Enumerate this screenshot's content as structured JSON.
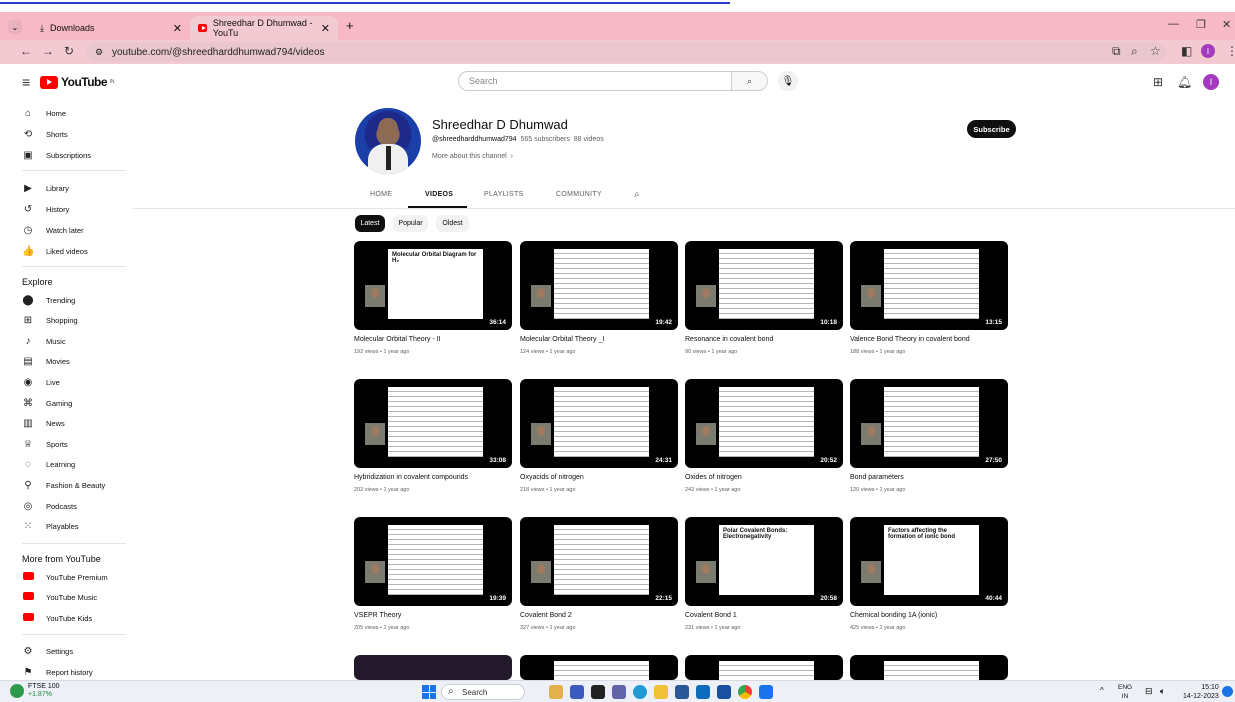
{
  "browser": {
    "tabs": [
      {
        "label": "Downloads",
        "active": false
      },
      {
        "label": "Shreedhar D Dhumwad - YouTu",
        "active": true
      }
    ],
    "url": "youtube.com/@shreedharddhumwad794/videos"
  },
  "header": {
    "logo": "YouTube",
    "logo_region": "IN",
    "search_placeholder": "Search",
    "profile_initial": "I"
  },
  "sidebar": {
    "main": [
      {
        "label": "Home",
        "icon": "home-icon",
        "glyph": "⌂"
      },
      {
        "label": "Shorts",
        "icon": "shorts-icon",
        "glyph": "⟲"
      },
      {
        "label": "Subscriptions",
        "icon": "subscriptions-icon",
        "glyph": "▣"
      }
    ],
    "you": [
      {
        "label": "Library",
        "icon": "library-icon",
        "glyph": "▶"
      },
      {
        "label": "History",
        "icon": "history-icon",
        "glyph": "↺"
      },
      {
        "label": "Watch later",
        "icon": "watch-later-icon",
        "glyph": "◷"
      },
      {
        "label": "Liked videos",
        "icon": "thumbs-up-icon",
        "glyph": "👍"
      }
    ],
    "explore_heading": "Explore",
    "explore": [
      {
        "label": "Trending",
        "icon": "trending-icon",
        "glyph": "⬤"
      },
      {
        "label": "Shopping",
        "icon": "shopping-icon",
        "glyph": "⊞"
      },
      {
        "label": "Music",
        "icon": "music-icon",
        "glyph": "♪"
      },
      {
        "label": "Movies",
        "icon": "movies-icon",
        "glyph": "▤"
      },
      {
        "label": "Live",
        "icon": "live-icon",
        "glyph": "◉"
      },
      {
        "label": "Gaming",
        "icon": "gaming-icon",
        "glyph": "⌘"
      },
      {
        "label": "News",
        "icon": "news-icon",
        "glyph": "▥"
      },
      {
        "label": "Sports",
        "icon": "sports-icon",
        "glyph": "♕"
      },
      {
        "label": "Learning",
        "icon": "learning-icon",
        "glyph": "◌"
      },
      {
        "label": "Fashion & Beauty",
        "icon": "fashion-icon",
        "glyph": "⚲"
      },
      {
        "label": "Podcasts",
        "icon": "podcasts-icon",
        "glyph": "◎"
      },
      {
        "label": "Playables",
        "icon": "playables-icon",
        "glyph": "⁙"
      }
    ],
    "more_heading": "More from YouTube",
    "more": [
      {
        "label": "YouTube Premium",
        "icon": "youtube-premium-icon",
        "color": "#ff0000"
      },
      {
        "label": "YouTube Music",
        "icon": "youtube-music-icon",
        "color": "#ff0000"
      },
      {
        "label": "YouTube Kids",
        "icon": "youtube-kids-icon",
        "color": "#ff0000"
      }
    ],
    "settings": [
      {
        "label": "Settings",
        "icon": "settings-icon",
        "glyph": "⚙"
      },
      {
        "label": "Report history",
        "icon": "flag-icon",
        "glyph": "⚑"
      }
    ]
  },
  "channel": {
    "name": "Shreedhar D Dhumwad",
    "handle": "@shreedharddhumwad794",
    "subscribers": "565 subscribers",
    "video_count": "88 videos",
    "more_about": "More about this channel",
    "subscribe_label": "Subscribe"
  },
  "channel_tabs": [
    "HOME",
    "VIDEOS",
    "PLAYLISTS",
    "COMMUNITY"
  ],
  "filters": [
    "Latest",
    "Popular",
    "Oldest"
  ],
  "videos": [
    {
      "title": "Molecular Orbital Theory - II",
      "meta": "192 views • 1 year ago",
      "duration": "36:14",
      "overlay": "Molecular Orbital Diagram for H₂"
    },
    {
      "title": "Molecular Orbital Theory _I",
      "meta": "124 views • 1 year ago",
      "duration": "19:42"
    },
    {
      "title": "Resonance in covalent bond",
      "meta": "90 views • 1 year ago",
      "duration": "10:18"
    },
    {
      "title": "Valence Bond Theory in covalent bond",
      "meta": "188 views • 1 year ago",
      "duration": "13:15"
    },
    {
      "title": "Hybridization in covalent compounds",
      "meta": "202 views • 1 year ago",
      "duration": "33:08"
    },
    {
      "title": "Oxyacids of nitrogen",
      "meta": "218 views • 1 year ago",
      "duration": "24:31"
    },
    {
      "title": "Oxides of nitrogen",
      "meta": "242 views • 1 year ago",
      "duration": "20:52"
    },
    {
      "title": "Bond parameters",
      "meta": "120 views • 1 year ago",
      "duration": "27:50"
    },
    {
      "title": "VSEPR Theory",
      "meta": "205 views • 1 year ago",
      "duration": "19:39"
    },
    {
      "title": "Covalent Bond 2",
      "meta": "327 views • 1 year ago",
      "duration": "22:15"
    },
    {
      "title": "Covalent Bond 1",
      "meta": "231 views • 1 year ago",
      "duration": "20:58",
      "overlay": "Polar Covalent Bonds: Electronegativity"
    },
    {
      "title": "Chemical bonding 1A (ionic)",
      "meta": "425 views • 1 year ago",
      "duration": "40:44",
      "overlay": "Factors affecting the formation of ionic bond"
    }
  ],
  "taskbar": {
    "ticker_name": "FTSE 100",
    "ticker_change": "+1.87%",
    "search_label": "Search",
    "lang_top": "ENG",
    "lang_bottom": "IN",
    "time": "15:10",
    "date": "14-12-2023"
  }
}
